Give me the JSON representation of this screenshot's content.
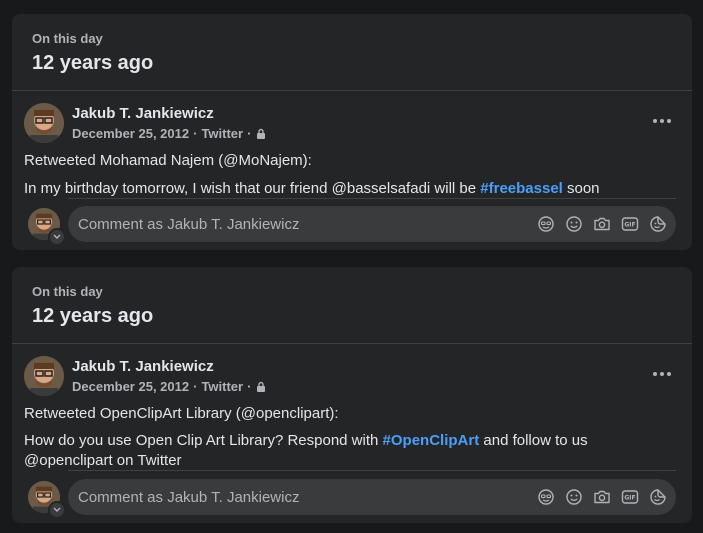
{
  "memories": [
    {
      "eyebrow": "On this day",
      "years_ago": "12 years ago",
      "post": {
        "author": "Jakub T. Jankiewicz",
        "date": "December 25, 2012",
        "source": "Twitter",
        "separator": "·",
        "line1": "Retweeted Mohamad Najem (@MoNajem):",
        "line2_pre": "In my birthday tomorrow, I wish that our friend @basselsafadi will be ",
        "line2_tag": "#freebassel",
        "line2_post": " soon",
        "line2b": ""
      },
      "comment_placeholder": "Comment as Jakub T. Jankiewicz"
    },
    {
      "eyebrow": "On this day",
      "years_ago": "12 years ago",
      "post": {
        "author": "Jakub T. Jankiewicz",
        "date": "December 25, 2012",
        "source": "Twitter",
        "separator": "·",
        "line1": "Retweeted OpenClipArt Library (@openclipart):",
        "line2_pre": "How do you use Open Clip Art Library? Respond with ",
        "line2_tag": "#OpenClipArt",
        "line2_post": " and follow to us",
        "line2b": "@openclipart on Twitter"
      },
      "comment_placeholder": "Comment as Jakub T. Jankiewicz"
    }
  ],
  "icons": {
    "privacy": "lock-icon",
    "more": "more-options-icon",
    "comment_tools": [
      "avatar-sticker-icon",
      "emoji-icon",
      "camera-icon",
      "gif-icon",
      "sticker-icon"
    ]
  },
  "colors": {
    "background": "#18191a",
    "card": "#242526",
    "hashtag": "#4b9ff9",
    "secondary_text": "#b0b3b8"
  }
}
